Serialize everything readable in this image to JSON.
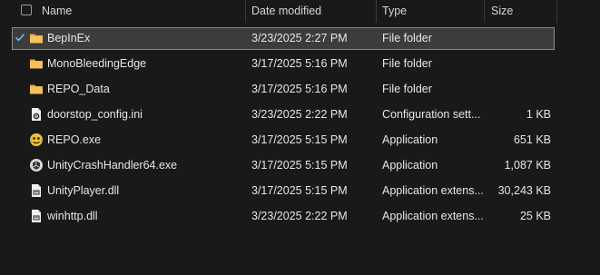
{
  "header": {
    "name": "Name",
    "date": "Date modified",
    "type": "Type",
    "size": "Size",
    "sort_indicator": "^"
  },
  "colors": {
    "folder": "#f4c25a",
    "selection": "#3c3c3c",
    "checkmark": "#6fb2ff"
  },
  "files": [
    {
      "name": "BepInEx",
      "date": "3/23/2025 2:27 PM",
      "type": "File folder",
      "size": "",
      "icon": "folder-icon",
      "selected": true
    },
    {
      "name": "MonoBleedingEdge",
      "date": "3/17/2025 5:16 PM",
      "type": "File folder",
      "size": "",
      "icon": "folder-icon"
    },
    {
      "name": "REPO_Data",
      "date": "3/17/2025 5:16 PM",
      "type": "File folder",
      "size": "",
      "icon": "folder-icon"
    },
    {
      "name": "doorstop_config.ini",
      "date": "3/23/2025 2:22 PM",
      "type": "Configuration sett...",
      "size": "1 KB",
      "icon": "settings-file-icon"
    },
    {
      "name": "REPO.exe",
      "date": "3/17/2025 5:15 PM",
      "type": "Application",
      "size": "651 KB",
      "icon": "app-icon"
    },
    {
      "name": "UnityCrashHandler64.exe",
      "date": "3/17/2025 5:15 PM",
      "type": "Application",
      "size": "1,087 KB",
      "icon": "unity-icon"
    },
    {
      "name": "UnityPlayer.dll",
      "date": "3/17/2025 5:15 PM",
      "type": "Application extens...",
      "size": "30,243 KB",
      "icon": "dll-file-icon"
    },
    {
      "name": "winhttp.dll",
      "date": "3/23/2025 2:22 PM",
      "type": "Application extens...",
      "size": "25 KB",
      "icon": "dll-file-icon"
    }
  ]
}
